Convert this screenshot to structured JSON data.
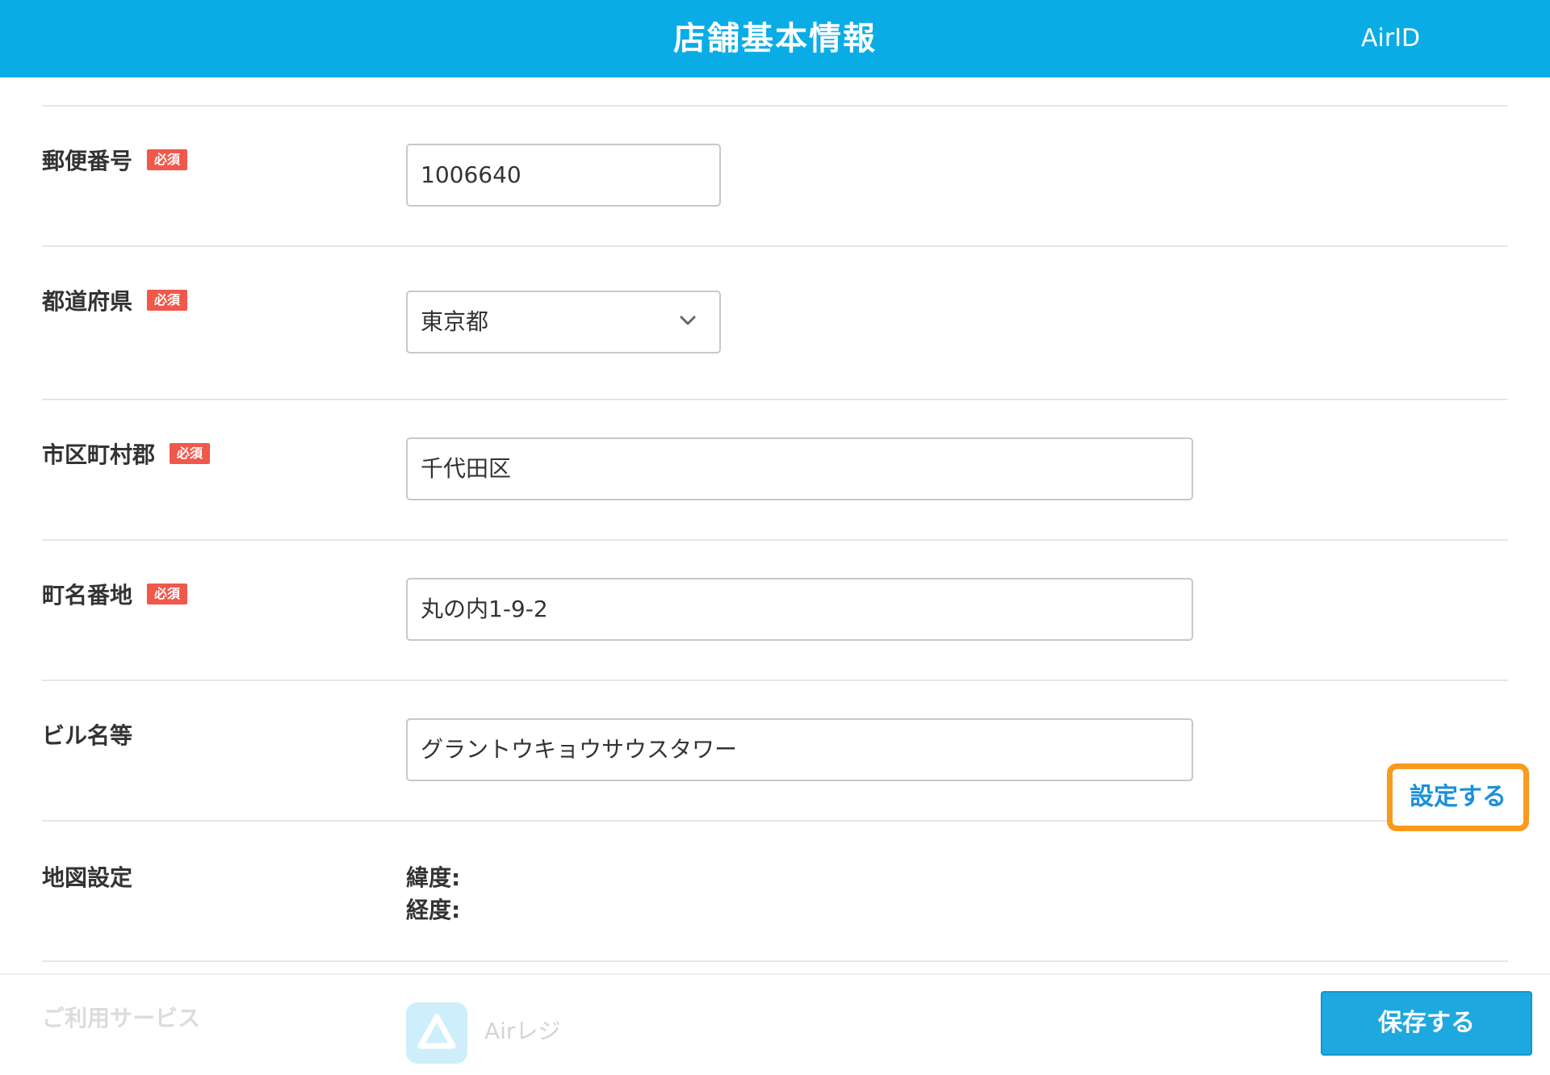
{
  "header": {
    "title": "店舗基本情報",
    "account_label": "AirID"
  },
  "required_badge": "必須",
  "fields": {
    "postal_code": {
      "label": "郵便番号",
      "value": "1006640"
    },
    "prefecture": {
      "label": "都道府県",
      "value": "東京都"
    },
    "city": {
      "label": "市区町村郡",
      "value": "千代田区"
    },
    "street": {
      "label": "町名番地",
      "value": "丸の内1-9-2"
    },
    "building": {
      "label": "ビル名等",
      "value": "グラントウキョウサウスタワー"
    }
  },
  "map": {
    "label": "地図設定",
    "latitude_label": "緯度:",
    "longitude_label": "経度:",
    "set_button": "設定する"
  },
  "footer": {
    "services_label": "ご利用サービス",
    "app_name": "Airレジ",
    "app_icon": "airregi-triangle-icon",
    "save_button": "保存する"
  },
  "colors": {
    "header_bg": "#0aace6",
    "badge_bg": "#f0584b",
    "highlight": "#f99a1c",
    "link": "#1a90d8",
    "save_bg": "#1ea8e0"
  }
}
